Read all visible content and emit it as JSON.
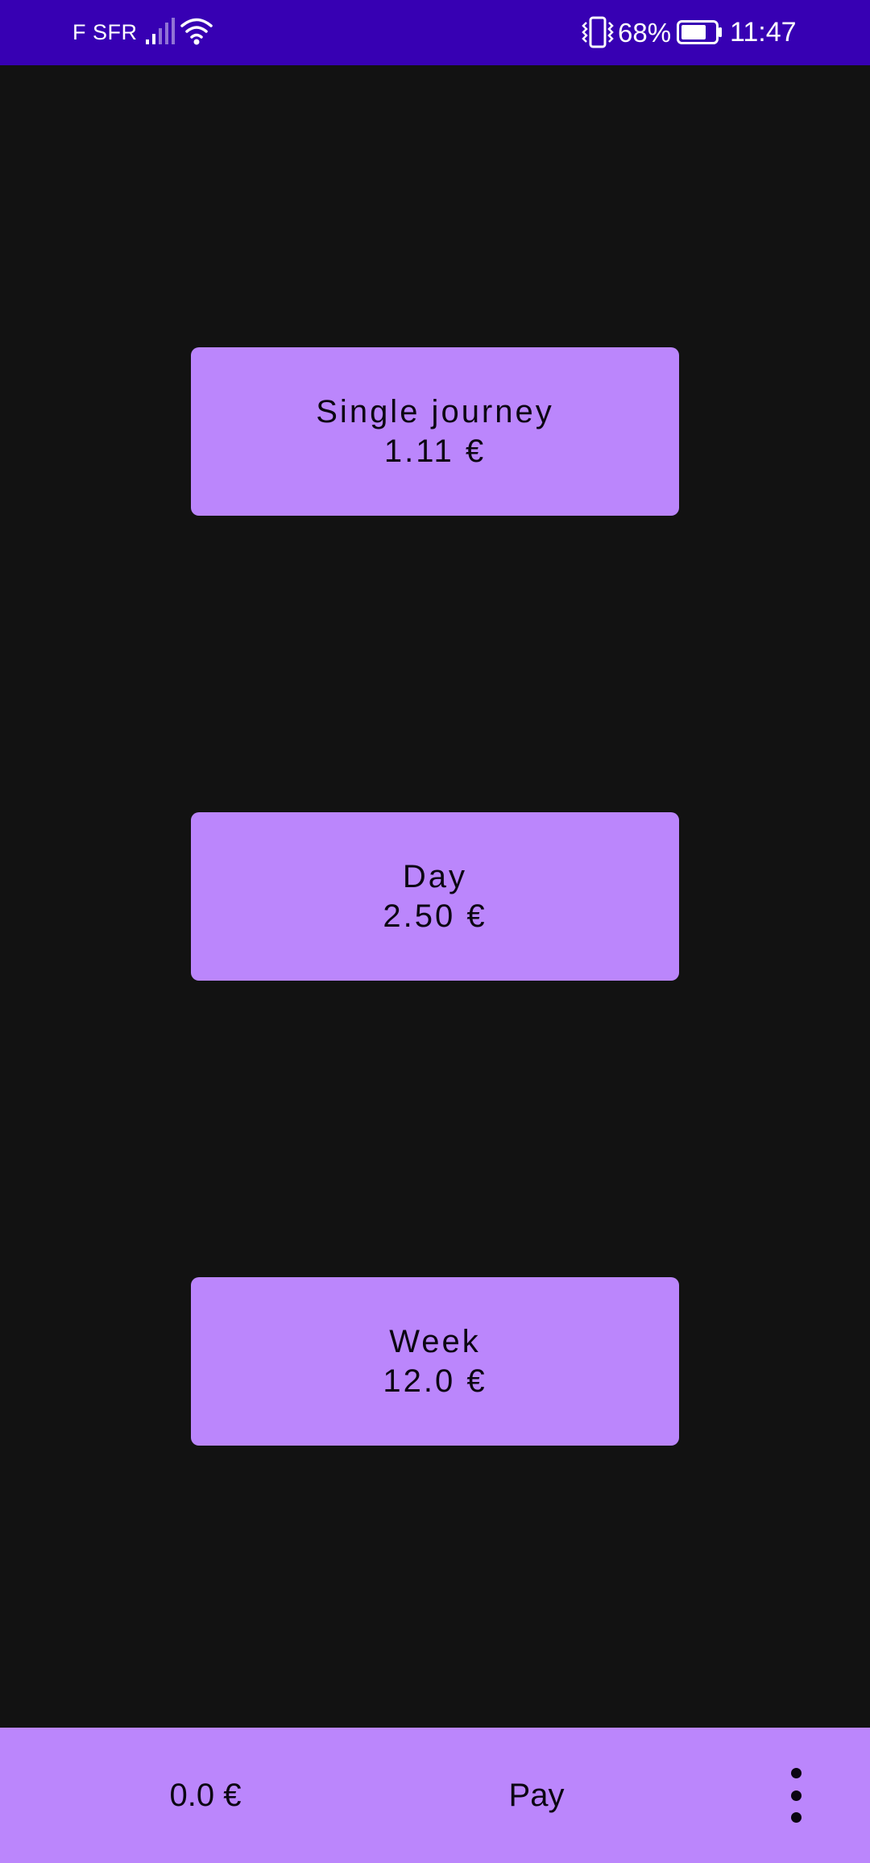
{
  "status_bar": {
    "carrier": "F SFR",
    "battery_percent": "68%",
    "time": "11:47",
    "icons": [
      "signal-icon",
      "wifi-icon",
      "vibrate-icon",
      "battery-icon"
    ],
    "color": "#3700b3"
  },
  "tickets": [
    {
      "name": "Single journey",
      "price": "1.11 €"
    },
    {
      "name": "Day",
      "price": "2.50 €"
    },
    {
      "name": "Week",
      "price": "12.0 €"
    }
  ],
  "bottom_bar": {
    "total": "0.0 €",
    "pay_label": "Pay",
    "menu_icon": "more-vert-icon"
  },
  "colors": {
    "background": "#121212",
    "accent": "#bb86fc",
    "status_bar": "#3700b3"
  }
}
